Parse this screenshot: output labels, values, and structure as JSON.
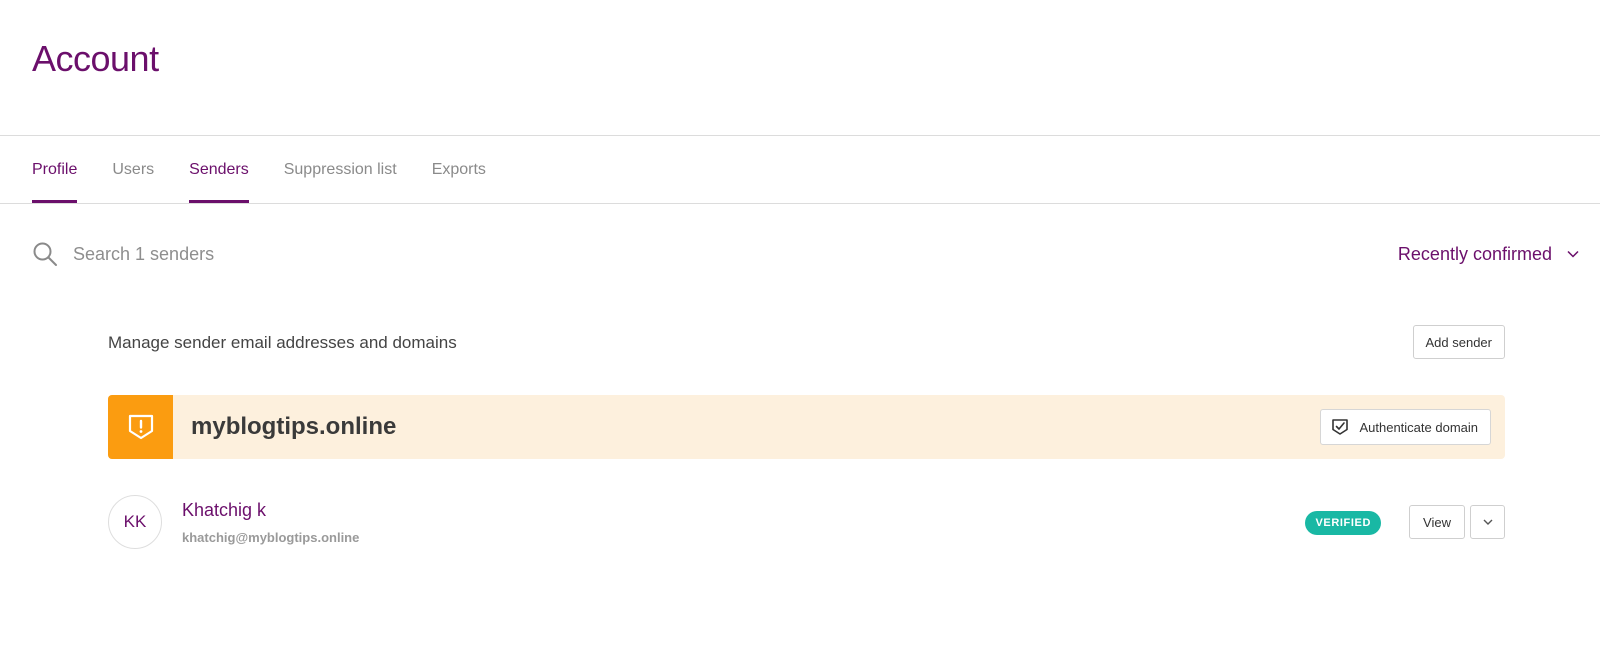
{
  "header": {
    "title": "Account"
  },
  "tabs": [
    {
      "label": "Profile",
      "active": true
    },
    {
      "label": "Users",
      "active": false
    },
    {
      "label": "Senders",
      "active": true
    },
    {
      "label": "Suppression list",
      "active": false
    },
    {
      "label": "Exports",
      "active": false
    }
  ],
  "search": {
    "placeholder": "Search 1 senders",
    "value": ""
  },
  "sort": {
    "selected": "Recently confirmed"
  },
  "senders": {
    "description": "Manage sender email addresses and domains",
    "add_label": "Add sender",
    "domain": {
      "name": "myblogtips.online",
      "authenticate_label": "Authenticate domain"
    },
    "items": [
      {
        "initials": "KK",
        "name": "Khatchig k",
        "email": "khatchig@myblogtips.online",
        "status": "VERIFIED",
        "view_label": "View"
      }
    ]
  },
  "colors": {
    "brand": "#6b0f6b",
    "warning": "#fb9c10",
    "warning_bg": "#fdf0dd",
    "verified": "#19b8a4"
  },
  "icons": {
    "search": "search-icon",
    "sort": "chevron-down-icon",
    "warning": "warning-shield-icon",
    "authenticate": "shield-check-icon",
    "more": "chevron-down-icon"
  }
}
